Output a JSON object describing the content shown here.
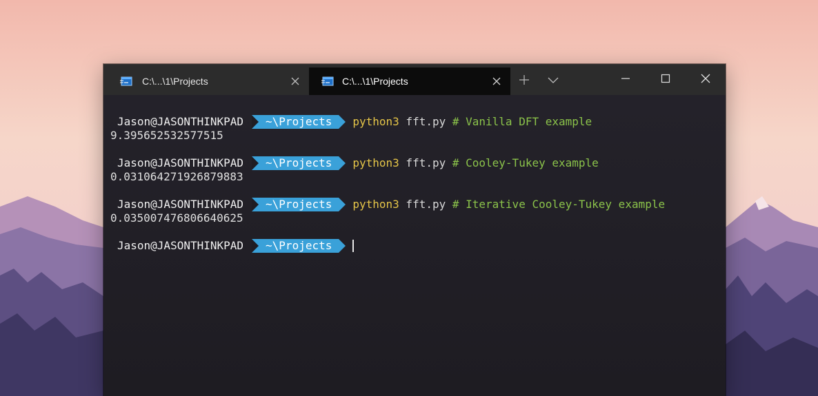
{
  "colors": {
    "accent": "#3aa1d9",
    "command": "#e5c548",
    "comment": "#8bc34a",
    "terminal_bg": "#232129",
    "titlebar_bg": "#2c2c2c",
    "active_tab_bg": "#0c0c0c"
  },
  "tabs": [
    {
      "title": "C:\\...\\1\\Projects",
      "icon": "terminal-icon",
      "close_icon": "close-icon",
      "active": false
    },
    {
      "title": "C:\\...\\1\\Projects",
      "icon": "terminal-icon",
      "close_icon": "close-icon",
      "active": true
    }
  ],
  "toolbar": {
    "new_tab_icon": "plus-icon",
    "dropdown_icon": "chevron-down-icon",
    "minimize_icon": "minimize-icon",
    "maximize_icon": "maximize-icon",
    "close_icon": "close-icon"
  },
  "terminal": {
    "lines": [
      {
        "user": "Jason@JASONTHINKPAD",
        "path": "~\\Projects",
        "command": "python3",
        "args": " fft.py ",
        "comment": "# Vanilla DFT example",
        "output": "9.395652532577515"
      },
      {
        "user": "Jason@JASONTHINKPAD",
        "path": "~\\Projects",
        "command": "python3",
        "args": " fft.py ",
        "comment": "# Cooley-Tukey example",
        "output": "0.031064271926879883"
      },
      {
        "user": "Jason@JASONTHINKPAD",
        "path": "~\\Projects",
        "command": "python3",
        "args": " fft.py ",
        "comment": "# Iterative Cooley-Tukey example",
        "output": "0.035007476806640625"
      },
      {
        "user": "Jason@JASONTHINKPAD",
        "path": "~\\Projects"
      }
    ]
  }
}
